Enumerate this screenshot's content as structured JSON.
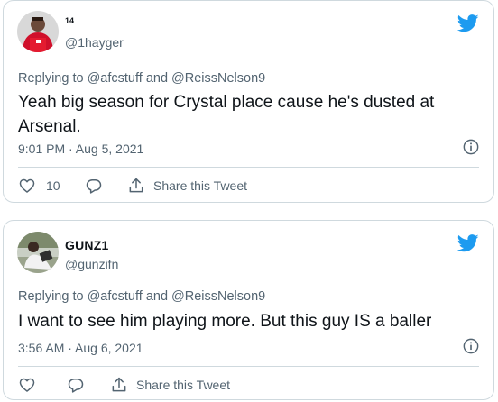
{
  "tweets": [
    {
      "name": "14",
      "handle": "@1hayger",
      "replying_prefix": "Replying to",
      "mention_1": "@afcstuff",
      "and": "and",
      "mention_2": "@ReissNelson9",
      "text": "Yeah big season for Crystal place cause he's dusted at Arsenal.",
      "timestamp": "9:01 PM · Aug 5, 2021",
      "like_count": "10",
      "share_label": "Share this Tweet",
      "avatar_icon": "avatar-arsenal-player-icon"
    },
    {
      "name": "GUNZ1",
      "handle": "@gunzifn",
      "replying_prefix": "Replying to",
      "mention_1": "@afcstuff",
      "and": "and",
      "mention_2": "@ReissNelson9",
      "text": "I want to see him playing more. But this guy IS a baller",
      "timestamp": "3:56 AM · Aug 6, 2021",
      "like_count": "",
      "share_label": "Share this Tweet",
      "avatar_icon": "avatar-photo-icon"
    }
  ],
  "colors": {
    "twitter_blue": "#1d9bf0",
    "secondary_text": "#536471",
    "border": "#cfd9de",
    "primary_text": "#0f1419"
  }
}
